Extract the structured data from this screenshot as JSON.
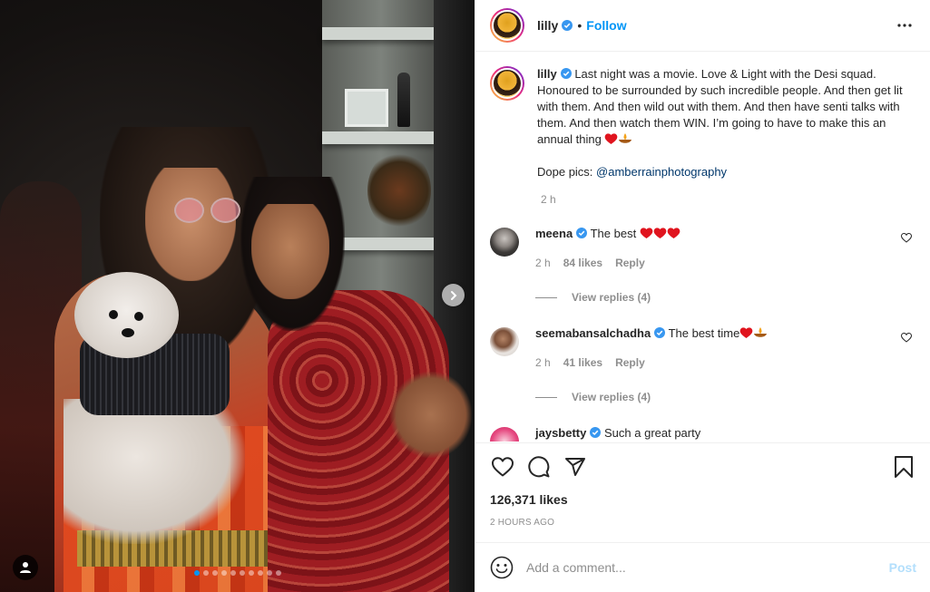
{
  "post": {
    "author": "lilly",
    "follow_label": "Follow",
    "separator": "•",
    "caption": "Last night was a movie. Love & Light with the Desi squad. Honoured to be surrounded by such incredible people. And then get lit with them. And then wild out with them. And then have senti talks with them. And then watch them WIN. I’m going to have to make this an annual thing",
    "credits_label": "Dope pics:",
    "credits_mention": "@amberrainphotography",
    "caption_time": "2 h",
    "likes": "126,371 likes",
    "date": "2 HOURS AGO"
  },
  "comments": [
    {
      "username": "meena",
      "text": "The best",
      "time": "2 h",
      "likes": "84 likes",
      "reply_label": "Reply",
      "view_replies": "View replies (4)"
    },
    {
      "username": "seemabansalchadha",
      "text": "The best time",
      "time": "2 h",
      "likes": "41 likes",
      "reply_label": "Reply",
      "view_replies": "View replies (4)"
    },
    {
      "username": "jaysbetty",
      "text": "Such a great party"
    }
  ],
  "add_comment": {
    "placeholder": "Add a comment...",
    "post_label": "Post"
  },
  "carousel": {
    "slide_count": 10,
    "active_index": 0
  },
  "colors": {
    "accent": "#0095f6",
    "text": "#262626",
    "muted": "#8e8e8e",
    "heart_red": "#ed4956",
    "post_disabled": "#b3dffc"
  }
}
